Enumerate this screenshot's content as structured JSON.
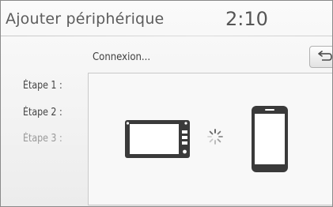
{
  "header": {
    "title": "Ajouter périphérique",
    "clock": "2:10"
  },
  "status": {
    "text": "Connexion..."
  },
  "steps": [
    {
      "label": "Étape 1 :",
      "active": false
    },
    {
      "label": "Étape 2 :",
      "active": false
    },
    {
      "label": "Étape 3 :",
      "active": true
    }
  ],
  "icons": {
    "back": "back-arrow-icon",
    "head_unit": "car-display-icon",
    "spinner": "loading-spinner-icon",
    "phone": "smartphone-icon"
  },
  "colors": {
    "text": "#5c5c5c",
    "device_outline": "#3a3a3a",
    "step_inactive": "#9a9a9a"
  }
}
